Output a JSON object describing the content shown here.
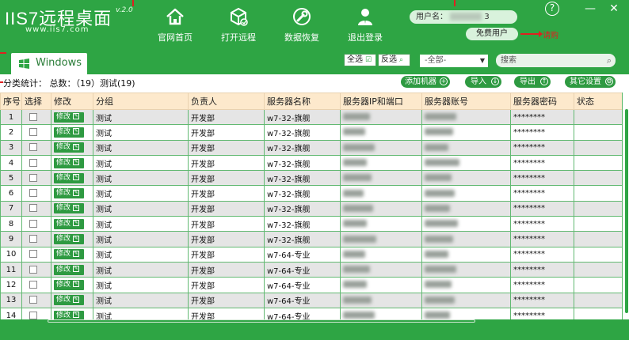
{
  "app": {
    "logo_text": "IIS7远程桌面",
    "version": "v.2.0",
    "url": "www.iis7.com"
  },
  "nav": [
    {
      "label": "官网首页",
      "icon": "home-icon"
    },
    {
      "label": "打开远程",
      "icon": "box-icon"
    },
    {
      "label": "数据恢复",
      "icon": "wrench-icon"
    },
    {
      "label": "退出登录",
      "icon": "user-icon"
    }
  ],
  "user": {
    "label": "用户名：",
    "name_tail": "3",
    "free_label": "免费用户",
    "upgrade_label": "请购"
  },
  "window_controls": {
    "help": "?",
    "minimize": "—",
    "close": "✕"
  },
  "toolbar": {
    "tab_label": "Windows",
    "select_all": "全选",
    "invert": "反选",
    "group_select": "-全部-",
    "search_placeholder": "搜索"
  },
  "stats": {
    "text": "分类统计： 总数：（19）测试(19)"
  },
  "actions": {
    "add": "添加机器",
    "import": "导入",
    "export": "导出",
    "settings": "其它设置"
  },
  "table": {
    "columns": [
      "序号",
      "选择",
      "修改",
      "分组",
      "负责人",
      "服务器名称",
      "服务器IP和端口",
      "服务器账号",
      "服务器密码",
      "状态"
    ],
    "edit_label": "修改",
    "rows": [
      {
        "no": "1",
        "group": "测试",
        "owner": "开发部",
        "server": "w7-32-旗舰",
        "password": "********",
        "status": ""
      },
      {
        "no": "2",
        "group": "测试",
        "owner": "开发部",
        "server": "w7-32-旗舰",
        "password": "********",
        "status": ""
      },
      {
        "no": "3",
        "group": "测试",
        "owner": "开发部",
        "server": "w7-32-旗舰",
        "password": "********",
        "status": ""
      },
      {
        "no": "4",
        "group": "测试",
        "owner": "开发部",
        "server": "w7-32-旗舰",
        "password": "********",
        "status": ""
      },
      {
        "no": "5",
        "group": "测试",
        "owner": "开发部",
        "server": "w7-32-旗舰",
        "password": "********",
        "status": ""
      },
      {
        "no": "6",
        "group": "测试",
        "owner": "开发部",
        "server": "w7-32-旗舰",
        "password": "********",
        "status": ""
      },
      {
        "no": "7",
        "group": "测试",
        "owner": "开发部",
        "server": "w7-32-旗舰",
        "password": "********",
        "status": ""
      },
      {
        "no": "8",
        "group": "测试",
        "owner": "开发部",
        "server": "w7-32-旗舰",
        "password": "********",
        "status": ""
      },
      {
        "no": "9",
        "group": "测试",
        "owner": "开发部",
        "server": "w7-32-旗舰",
        "password": "********",
        "status": ""
      },
      {
        "no": "10",
        "group": "测试",
        "owner": "开发部",
        "server": "w7-64-专业",
        "password": "********",
        "status": ""
      },
      {
        "no": "11",
        "group": "测试",
        "owner": "开发部",
        "server": "w7-64-专业",
        "password": "********",
        "status": ""
      },
      {
        "no": "12",
        "group": "测试",
        "owner": "开发部",
        "server": "w7-64-专业",
        "password": "********",
        "status": ""
      },
      {
        "no": "13",
        "group": "测试",
        "owner": "开发部",
        "server": "w7-64-专业",
        "password": "********",
        "status": ""
      },
      {
        "no": "14",
        "group": "测试",
        "owner": "开发部",
        "server": "w7-64-专业",
        "password": "********",
        "status": ""
      }
    ]
  },
  "colors": {
    "brand_green": "#2ea544",
    "header_row": "#fde9cc",
    "alert_red": "#e02020"
  }
}
